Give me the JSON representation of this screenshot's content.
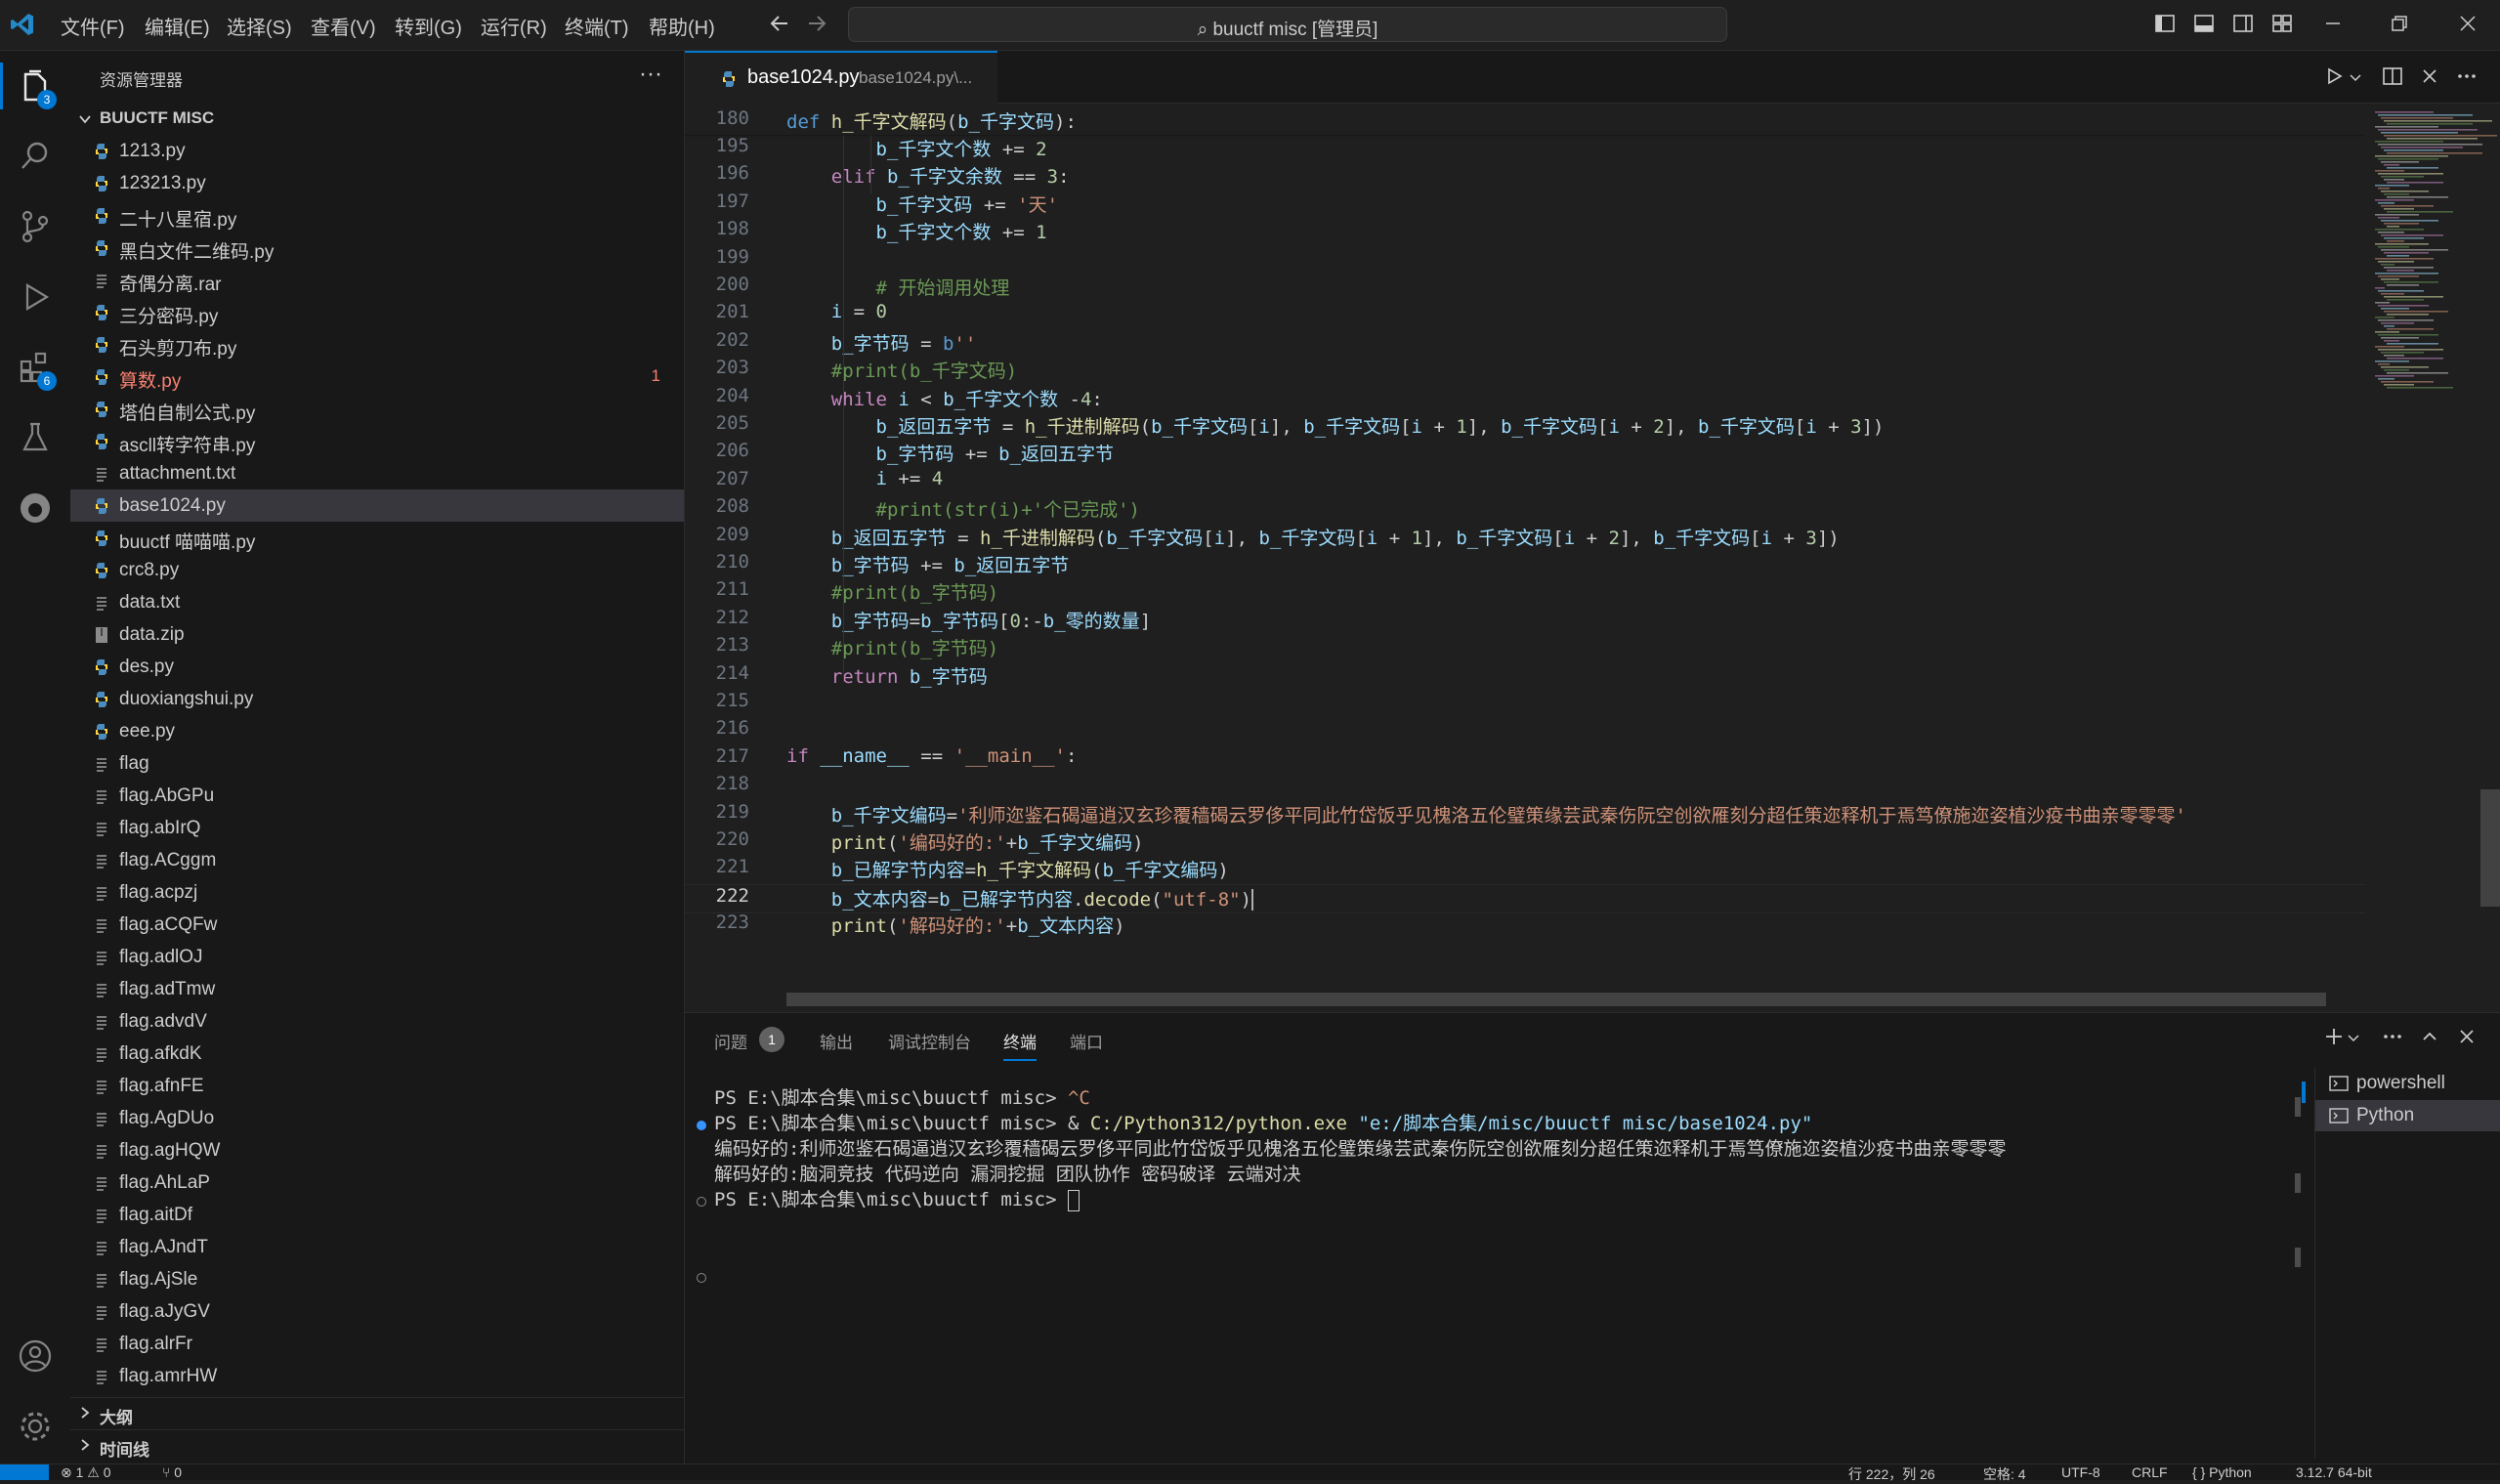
{
  "menu": [
    "文件(F)",
    "编辑(E)",
    "选择(S)",
    "查看(V)",
    "转到(G)",
    "运行(R)",
    "终端(T)",
    "帮助(H)"
  ],
  "search": {
    "text": "buuctf misc [管理员]"
  },
  "activity": {
    "explorer_badge": "3",
    "extensions_badge": "6"
  },
  "sidebar": {
    "title": "资源管理器",
    "more": "···",
    "folder": "BUUCTF MISC",
    "files": [
      {
        "name": "1213.py",
        "type": "py"
      },
      {
        "name": "123213.py",
        "type": "py"
      },
      {
        "name": "二十八星宿.py",
        "type": "py"
      },
      {
        "name": "黑白文件二维码.py",
        "type": "py"
      },
      {
        "name": "奇偶分离.rar",
        "type": "txt"
      },
      {
        "name": "三分密码.py",
        "type": "py"
      },
      {
        "name": "石头剪刀布.py",
        "type": "py"
      },
      {
        "name": "算数.py",
        "type": "py",
        "error": "1"
      },
      {
        "name": "塔伯自制公式.py",
        "type": "py"
      },
      {
        "name": "ascll转字符串.py",
        "type": "py"
      },
      {
        "name": "attachment.txt",
        "type": "txt"
      },
      {
        "name": "base1024.py",
        "type": "py",
        "selected": true
      },
      {
        "name": "buuctf 喵喵喵.py",
        "type": "py"
      },
      {
        "name": "crc8.py",
        "type": "py"
      },
      {
        "name": "data.txt",
        "type": "txt"
      },
      {
        "name": "data.zip",
        "type": "zip"
      },
      {
        "name": "des.py",
        "type": "py"
      },
      {
        "name": "duoxiangshui.py",
        "type": "py"
      },
      {
        "name": "eee.py",
        "type": "py"
      },
      {
        "name": "flag",
        "type": "txt"
      },
      {
        "name": "flag.AbGPu",
        "type": "txt"
      },
      {
        "name": "flag.abIrQ",
        "type": "txt"
      },
      {
        "name": "flag.ACggm",
        "type": "txt"
      },
      {
        "name": "flag.acpzj",
        "type": "txt"
      },
      {
        "name": "flag.aCQFw",
        "type": "txt"
      },
      {
        "name": "flag.adlOJ",
        "type": "txt"
      },
      {
        "name": "flag.adTmw",
        "type": "txt"
      },
      {
        "name": "flag.advdV",
        "type": "txt"
      },
      {
        "name": "flag.afkdK",
        "type": "txt"
      },
      {
        "name": "flag.afnFE",
        "type": "txt"
      },
      {
        "name": "flag.AgDUo",
        "type": "txt"
      },
      {
        "name": "flag.agHQW",
        "type": "txt"
      },
      {
        "name": "flag.AhLaP",
        "type": "txt"
      },
      {
        "name": "flag.aitDf",
        "type": "txt"
      },
      {
        "name": "flag.AJndT",
        "type": "txt"
      },
      {
        "name": "flag.AjSle",
        "type": "txt"
      },
      {
        "name": "flag.aJyGV",
        "type": "txt"
      },
      {
        "name": "flag.alrFr",
        "type": "txt"
      },
      {
        "name": "flag.amrHW",
        "type": "txt"
      }
    ],
    "sections": [
      "大纲",
      "时间线"
    ]
  },
  "editor": {
    "tab_label": "base1024.py",
    "tab_desc": "base1024.py\\...",
    "lines": [
      {
        "n": "180",
        "t": [
          [
            "kd",
            "def "
          ],
          [
            "fn",
            "h_千字文解码"
          ],
          [
            "",
            "("
          ],
          [
            "vr",
            "b_千字文码"
          ],
          [
            "",
            "):"
          ]
        ]
      },
      {
        "n": "195",
        "t": [
          [
            "",
            "        "
          ],
          [
            "vr",
            "b_千字文个数"
          ],
          [
            "",
            " += "
          ],
          [
            "nm",
            "2"
          ]
        ]
      },
      {
        "n": "196",
        "t": [
          [
            "",
            "    "
          ],
          [
            "kw",
            "elif "
          ],
          [
            "vr",
            "b_千字文余数"
          ],
          [
            "",
            " == "
          ],
          [
            "nm",
            "3"
          ],
          [
            "",
            ":"
          ]
        ]
      },
      {
        "n": "197",
        "t": [
          [
            "",
            "        "
          ],
          [
            "vr",
            "b_千字文码"
          ],
          [
            "",
            " += "
          ],
          [
            "st",
            "'天'"
          ]
        ]
      },
      {
        "n": "198",
        "t": [
          [
            "",
            "        "
          ],
          [
            "vr",
            "b_千字文个数"
          ],
          [
            "",
            " += "
          ],
          [
            "nm",
            "1"
          ]
        ]
      },
      {
        "n": "199",
        "t": []
      },
      {
        "n": "200",
        "t": [
          [
            "",
            "        "
          ],
          [
            "cm",
            "# 开始调用处理"
          ]
        ]
      },
      {
        "n": "201",
        "t": [
          [
            "",
            "    "
          ],
          [
            "vr",
            "i"
          ],
          [
            "",
            " = "
          ],
          [
            "nm",
            "0"
          ]
        ]
      },
      {
        "n": "202",
        "t": [
          [
            "",
            "    "
          ],
          [
            "vr",
            "b_字节码"
          ],
          [
            "",
            " = "
          ],
          [
            "kd",
            "b"
          ],
          [
            "st",
            "''"
          ]
        ]
      },
      {
        "n": "203",
        "t": [
          [
            "",
            "    "
          ],
          [
            "cm",
            "#print(b_千字文码)"
          ]
        ]
      },
      {
        "n": "204",
        "t": [
          [
            "",
            "    "
          ],
          [
            "kw",
            "while "
          ],
          [
            "vr",
            "i"
          ],
          [
            "",
            " < "
          ],
          [
            "vr",
            "b_千字文个数"
          ],
          [
            "",
            " -"
          ],
          [
            "nm",
            "4"
          ],
          [
            "",
            ":"
          ]
        ]
      },
      {
        "n": "205",
        "t": [
          [
            "",
            "        "
          ],
          [
            "vr",
            "b_返回五字节"
          ],
          [
            "",
            " = "
          ],
          [
            "fn",
            "h_千进制解码"
          ],
          [
            "",
            "("
          ],
          [
            "vr",
            "b_千字文码"
          ],
          [
            "",
            "["
          ],
          [
            "vr",
            "i"
          ],
          [
            "",
            "], "
          ],
          [
            "vr",
            "b_千字文码"
          ],
          [
            "",
            "["
          ],
          [
            "vr",
            "i"
          ],
          [
            "",
            " + "
          ],
          [
            "nm",
            "1"
          ],
          [
            "",
            "], "
          ],
          [
            "vr",
            "b_千字文码"
          ],
          [
            "",
            "["
          ],
          [
            "vr",
            "i"
          ],
          [
            "",
            " + "
          ],
          [
            "nm",
            "2"
          ],
          [
            "",
            "], "
          ],
          [
            "vr",
            "b_千字文码"
          ],
          [
            "",
            "["
          ],
          [
            "vr",
            "i"
          ],
          [
            "",
            " + "
          ],
          [
            "nm",
            "3"
          ],
          [
            "",
            "])"
          ]
        ]
      },
      {
        "n": "206",
        "t": [
          [
            "",
            "        "
          ],
          [
            "vr",
            "b_字节码"
          ],
          [
            "",
            " += "
          ],
          [
            "vr",
            "b_返回五字节"
          ]
        ]
      },
      {
        "n": "207",
        "t": [
          [
            "",
            "        "
          ],
          [
            "vr",
            "i"
          ],
          [
            "",
            " += "
          ],
          [
            "nm",
            "4"
          ]
        ]
      },
      {
        "n": "208",
        "t": [
          [
            "",
            "        "
          ],
          [
            "cm",
            "#print(str(i)+'个已完成')"
          ]
        ]
      },
      {
        "n": "209",
        "t": [
          [
            "",
            "    "
          ],
          [
            "vr",
            "b_返回五字节"
          ],
          [
            "",
            " = "
          ],
          [
            "fn",
            "h_千进制解码"
          ],
          [
            "",
            "("
          ],
          [
            "vr",
            "b_千字文码"
          ],
          [
            "",
            "["
          ],
          [
            "vr",
            "i"
          ],
          [
            "",
            "], "
          ],
          [
            "vr",
            "b_千字文码"
          ],
          [
            "",
            "["
          ],
          [
            "vr",
            "i"
          ],
          [
            "",
            " + "
          ],
          [
            "nm",
            "1"
          ],
          [
            "",
            "], "
          ],
          [
            "vr",
            "b_千字文码"
          ],
          [
            "",
            "["
          ],
          [
            "vr",
            "i"
          ],
          [
            "",
            " + "
          ],
          [
            "nm",
            "2"
          ],
          [
            "",
            "], "
          ],
          [
            "vr",
            "b_千字文码"
          ],
          [
            "",
            "["
          ],
          [
            "vr",
            "i"
          ],
          [
            "",
            " + "
          ],
          [
            "nm",
            "3"
          ],
          [
            "",
            "])"
          ]
        ]
      },
      {
        "n": "210",
        "t": [
          [
            "",
            "    "
          ],
          [
            "vr",
            "b_字节码"
          ],
          [
            "",
            " += "
          ],
          [
            "vr",
            "b_返回五字节"
          ]
        ]
      },
      {
        "n": "211",
        "t": [
          [
            "",
            "    "
          ],
          [
            "cm",
            "#print(b_字节码)"
          ]
        ]
      },
      {
        "n": "212",
        "t": [
          [
            "",
            "    "
          ],
          [
            "vr",
            "b_字节码"
          ],
          [
            "",
            "="
          ],
          [
            "vr",
            "b_字节码"
          ],
          [
            "",
            "["
          ],
          [
            "nm",
            "0"
          ],
          [
            "",
            ":-"
          ],
          [
            "vr",
            "b_零的数量"
          ],
          [
            "",
            "]"
          ]
        ]
      },
      {
        "n": "213",
        "t": [
          [
            "",
            "    "
          ],
          [
            "cm",
            "#print(b_字节码)"
          ]
        ]
      },
      {
        "n": "214",
        "t": [
          [
            "",
            "    "
          ],
          [
            "kw",
            "return "
          ],
          [
            "vr",
            "b_字节码"
          ]
        ]
      },
      {
        "n": "215",
        "t": []
      },
      {
        "n": "216",
        "t": []
      },
      {
        "n": "217",
        "t": [
          [
            "kw",
            "if "
          ],
          [
            "vr",
            "__name__"
          ],
          [
            "",
            " == "
          ],
          [
            "st",
            "'__main__'"
          ],
          [
            "",
            ":"
          ]
        ]
      },
      {
        "n": "218",
        "t": []
      },
      {
        "n": "219",
        "t": [
          [
            "",
            "    "
          ],
          [
            "vr",
            "b_千字文编码"
          ],
          [
            "",
            "="
          ],
          [
            "st",
            "'利师迩鉴石碣逼逍汉玄珍覆穑碣云罗侈平同此竹岱饭乎见槐洛五伦璧策缘芸武秦伤阮空创欲雁刻分超任策迩释机于焉笃僚施迩姿植沙疫书曲亲零零零'"
          ]
        ]
      },
      {
        "n": "220",
        "t": [
          [
            "",
            "    "
          ],
          [
            "fn",
            "print"
          ],
          [
            "",
            "("
          ],
          [
            "st",
            "'编码好的:'"
          ],
          [
            "",
            "+"
          ],
          [
            "vr",
            "b_千字文编码"
          ],
          [
            "",
            ")"
          ]
        ]
      },
      {
        "n": "221",
        "t": [
          [
            "",
            "    "
          ],
          [
            "vr",
            "b_已解字节内容"
          ],
          [
            "",
            "="
          ],
          [
            "fn",
            "h_千字文解码"
          ],
          [
            "",
            "("
          ],
          [
            "vr",
            "b_千字文编码"
          ],
          [
            "",
            ")"
          ]
        ]
      },
      {
        "n": "222",
        "t": [
          [
            "",
            "    "
          ],
          [
            "vr",
            "b_文本内容"
          ],
          [
            "",
            "="
          ],
          [
            "vr",
            "b_已解字节内容"
          ],
          [
            "",
            "."
          ],
          [
            "fn",
            "decode"
          ],
          [
            "",
            "("
          ],
          [
            "st",
            "\"utf-8\""
          ],
          [
            "",
            ")"
          ]
        ],
        "current": true
      },
      {
        "n": "223",
        "t": [
          [
            "",
            "    "
          ],
          [
            "fn",
            "print"
          ],
          [
            "",
            "("
          ],
          [
            "st",
            "'解码好的:'"
          ],
          [
            "",
            "+"
          ],
          [
            "vr",
            "b_文本内容"
          ],
          [
            "",
            ")"
          ]
        ]
      }
    ]
  },
  "panel": {
    "tabs": [
      "问题",
      "输出",
      "调试控制台",
      "终端",
      "端口"
    ],
    "problems_count": "1",
    "active_tab": "终端",
    "terminal_lines": [
      [
        [
          "",
          "PS E:\\脚本合集\\misc\\buuctf misc> "
        ],
        [
          "st",
          "^C"
        ]
      ],
      [
        [
          "",
          "PS E:\\脚本合集\\misc\\buuctf misc> & "
        ],
        [
          "fn",
          "C:/Python312/python.exe"
        ],
        [
          "",
          " "
        ],
        [
          "vr",
          "\"e:/脚本合集/misc/buuctf misc/base1024.py\""
        ]
      ],
      [
        [
          "",
          "编码好的:利师迩鉴石碣逼逍汉玄珍覆穑碣云罗侈平同此竹岱饭乎见槐洛五伦璧策缘芸武秦伤阮空创欲雁刻分超任策迩释机于焉笃僚施迩姿植沙疫书曲亲零零零"
        ]
      ],
      [
        [
          "",
          "解码好的:脑洞竞技 代码逆向 漏洞挖掘 团队协作 密码破译 云端对决"
        ]
      ],
      [
        [
          "",
          "PS E:\\脚本合集\\misc\\buuctf misc> "
        ]
      ]
    ],
    "terminals": [
      "powershell",
      "Python"
    ]
  },
  "status": {
    "errors": "⊗ 1 ⚠ 0",
    "ports": "⑂ 0",
    "position": "行 222，列 26",
    "spaces": "空格: 4",
    "encoding": "UTF-8",
    "eol": "CRLF",
    "language": "{ } Python",
    "interpreter": "3.12.7 64-bit"
  },
  "colors": {
    "accent": "#0078d4",
    "background": "#1f1f1f",
    "sidebar": "#181818",
    "error": "#f88070"
  }
}
